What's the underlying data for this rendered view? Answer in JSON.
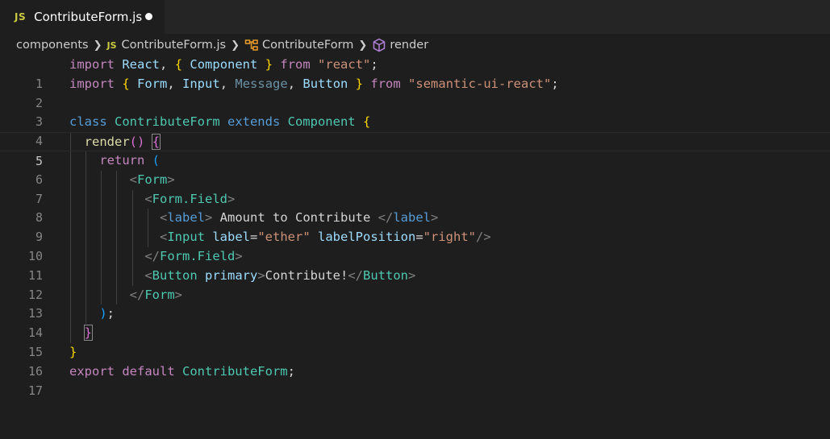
{
  "tab": {
    "badge": "JS",
    "title": "ContributeForm.js"
  },
  "breadcrumb": {
    "folder": "components",
    "file_badge": "JS",
    "file": "ContributeForm.js",
    "class": "ContributeForm",
    "method": "render"
  },
  "line_numbers": [
    "1",
    "2",
    "3",
    "4",
    "5",
    "6",
    "7",
    "8",
    "9",
    "10",
    "11",
    "12",
    "13",
    "14",
    "15",
    "16",
    "17"
  ],
  "code": {
    "l1": {
      "import": "import",
      "react": "React",
      "comma": ", ",
      "lb": "{",
      "component": " Component ",
      "rb": "}",
      "from": " from ",
      "src": "\"react\"",
      "semi": ";"
    },
    "l2": {
      "import": "import",
      "lb": " {",
      "form": " Form",
      "c1": ",",
      "input": " Input",
      "c2": ",",
      "message": " Message",
      "c3": ",",
      "button": " Button ",
      "rb": "}",
      "from": " from ",
      "src": "\"semantic-ui-react\"",
      "semi": ";"
    },
    "l4": {
      "class": "class",
      "name": " ContributeForm ",
      "extends": "extends",
      "base": " Component ",
      "lb": "{"
    },
    "l5": {
      "render": "render",
      "parens": "()",
      "lb": "{"
    },
    "l6": {
      "return": "return",
      "lp": " ("
    },
    "l7": {
      "lt": "<",
      "tag": "Form",
      "gt": ">"
    },
    "l8": {
      "lt": "<",
      "tag": "Form.Field",
      "gt": ">"
    },
    "l9": {
      "lt": "<",
      "tag": "label",
      "gt": ">",
      "text": " Amount to Contribute ",
      "clt": "</",
      "ctag": "label",
      "cgt": ">"
    },
    "l10": {
      "lt": "<",
      "tag": "Input",
      "a1": " label",
      "eq1": "=",
      "v1": "\"ether\"",
      "a2": " labelPosition",
      "eq2": "=",
      "v2": "\"right\"",
      "end": "/>"
    },
    "l11": {
      "clt": "</",
      "tag": "Form.Field",
      "gt": ">"
    },
    "l12": {
      "lt": "<",
      "tag": "Button",
      "attr": " primary",
      "gt": ">",
      "text": "Contribute!",
      "clt": "</",
      "ctag": "Button",
      "cgt": ">"
    },
    "l13": {
      "clt": "</",
      "tag": "Form",
      "gt": ">"
    },
    "l14": {
      "rp": ")",
      "semi": ";"
    },
    "l15": {
      "rb": "}"
    },
    "l16": {
      "rb": "}"
    },
    "l17": {
      "export": "export",
      "default": " default",
      "name": " ContributeForm",
      "semi": ";"
    }
  }
}
